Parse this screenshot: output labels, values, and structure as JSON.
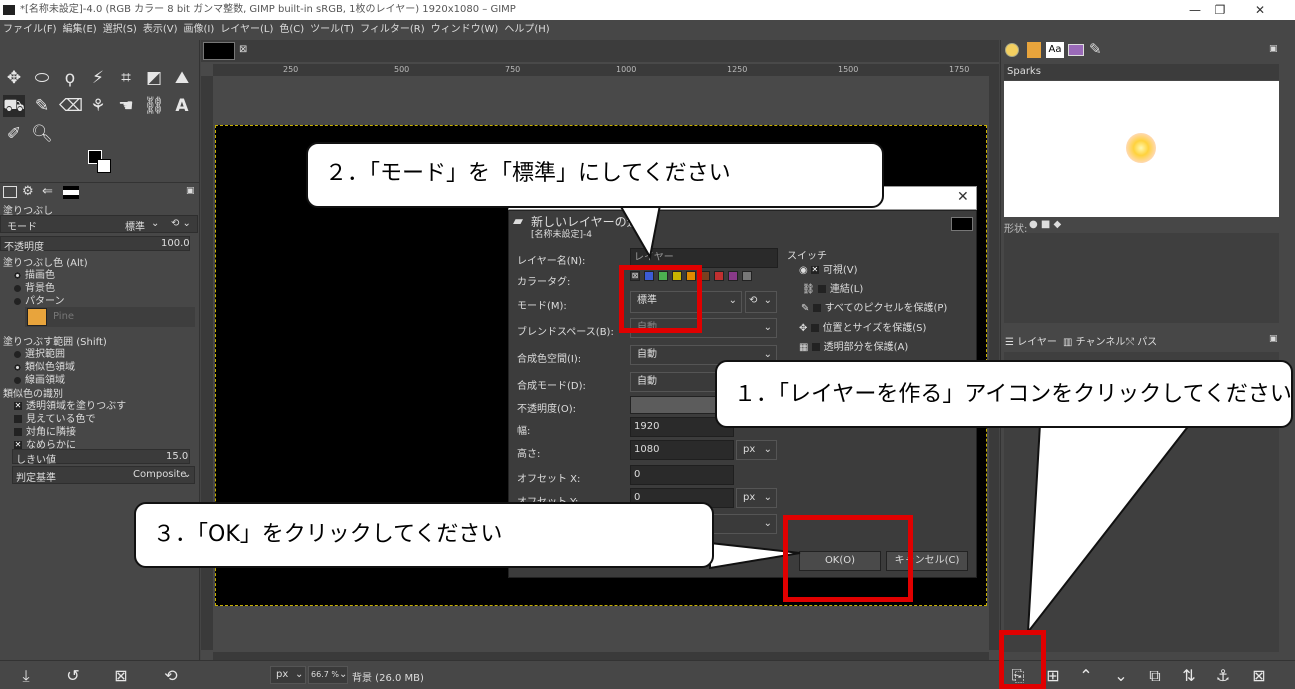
{
  "window": {
    "title": "*[名称未設定]-4.0 (RGB カラー 8 bit ガンマ整数, GIMP built-in sRGB, 1枚のレイヤー) 1920x1080 – GIMP",
    "minimize": "—",
    "maximize": "❐",
    "close": "✕"
  },
  "menu": [
    "ファイル(F)",
    "編集(E)",
    "選択(S)",
    "表示(V)",
    "画像(I)",
    "レイヤー(L)",
    "色(C)",
    "ツール(T)",
    "フィルター(R)",
    "ウィンドウ(W)",
    "ヘルプ(H)"
  ],
  "toolbox": {
    "panel_title": "塗りつぶし",
    "mode_label": "モード",
    "mode_value": "標準",
    "opacity_label": "不透明度",
    "opacity_value": "100.0",
    "fill_color_label": "塗りつぶし色 (Alt)",
    "fill_options": [
      "描画色",
      "背景色",
      "パターン"
    ],
    "pattern_name": "Pine",
    "fill_range_label": "塗りつぶす範囲 (Shift)",
    "range_options": [
      "選択範囲",
      "類似色領域",
      "線画領域"
    ],
    "similar_label": "類似色の識別",
    "similar_options": [
      "透明領域を塗りつぶす",
      "見えている色で",
      "対角に隣接",
      "なめらかに"
    ],
    "threshold_label": "しきい値",
    "threshold_value": "15.0",
    "criterion_label": "判定基準",
    "criterion_value": "Composite"
  },
  "ruler": {
    "ticks": [
      "250",
      "500",
      "750",
      "1000",
      "1250",
      "1500",
      "1750"
    ]
  },
  "statusbar": {
    "unit": "px",
    "zoom": "66.7 %",
    "info": "背景 (26.0 MB)"
  },
  "right_dock": {
    "brush_name": "Sparks",
    "shape_label": "形状:",
    "tabs": [
      "レイヤー",
      "チャンネル",
      "パス"
    ]
  },
  "dialog": {
    "title": "新しいレイヤーの追加",
    "subtitle": "[名称未設定]-4",
    "layer_name_label": "レイヤー名(N):",
    "layer_name_value": "レイヤー",
    "color_tag_label": "カラータグ:",
    "mode_label": "モード(M):",
    "mode_value": "標準",
    "blend_label": "ブレンドスペース(B):",
    "blend_value": "自動",
    "composite_space_label": "合成色空間(I):",
    "composite_space_value": "自動",
    "composite_mode_label": "合成モード(D):",
    "composite_mode_value": "自動",
    "opacity_label": "不透明度(O):",
    "width_label": "幅:",
    "width_value": "1920",
    "height_label": "高さ:",
    "height_value": "1080",
    "unit": "px",
    "offset_x_label": "オフセット X:",
    "offset_x_value": "0",
    "offset_y_label": "オフセット Y:",
    "offset_y_value": "0",
    "switch_title": "スイッチ",
    "switches": [
      "可視(V)",
      "連結(L)",
      "すべてのピクセルを保護(P)",
      "位置とサイズを保護(S)",
      "透明部分を保護(A)"
    ],
    "ok": "OK(O)",
    "cancel": "キャンセル(C)"
  },
  "callouts": {
    "step1": "１．「レイヤーを作る」アイコンをクリックしてください",
    "step2": "２．「モード」を「標準」にしてください",
    "step3": "３．「OK」をクリックしてください"
  },
  "colors": {
    "highlight": "#e00000",
    "tag_colors": [
      "#3c5bd6",
      "#4caf50",
      "#c8b400",
      "#e08a00",
      "#7a4020",
      "#c03030",
      "#8a3a8a",
      "#777777"
    ]
  }
}
